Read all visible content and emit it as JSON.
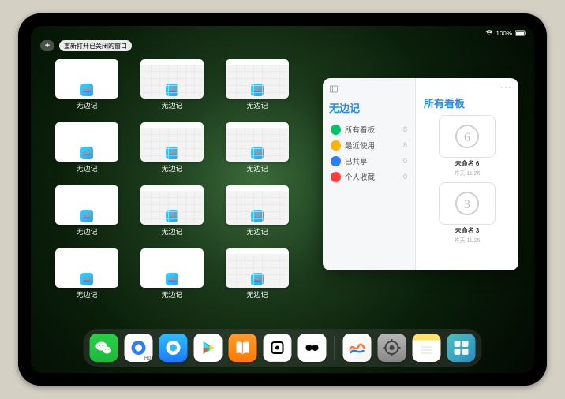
{
  "status": {
    "time": "",
    "battery": "100%"
  },
  "controls": {
    "plus_label": "+",
    "reopen_label": "重新打开已关闭的窗口"
  },
  "window_grid": {
    "app_label": "无边记",
    "items": [
      {
        "variant": "blank"
      },
      {
        "variant": "cal"
      },
      {
        "variant": "cal"
      },
      {
        "variant": "blank"
      },
      {
        "variant": "cal"
      },
      {
        "variant": "cal"
      },
      {
        "variant": "blank"
      },
      {
        "variant": "cal"
      },
      {
        "variant": "cal"
      },
      {
        "variant": "blank"
      },
      {
        "variant": "blank"
      },
      {
        "variant": "cal"
      }
    ]
  },
  "side_panel": {
    "left_title": "无边记",
    "categories": [
      {
        "label": "所有看板",
        "count": "8",
        "color": "#00c46a"
      },
      {
        "label": "最近使用",
        "count": "8",
        "color": "#ffb300"
      },
      {
        "label": "已共享",
        "count": "0",
        "color": "#2b7dff"
      },
      {
        "label": "个人收藏",
        "count": "0",
        "color": "#ff3b3b"
      }
    ],
    "right_title": "所有看板",
    "more_label": "···",
    "boards": [
      {
        "name": "未命名 6",
        "sub": "昨天 11:26",
        "digit": "6"
      },
      {
        "name": "未命名 3",
        "sub": "昨天 11:25",
        "digit": "3"
      }
    ]
  },
  "dock": {
    "icons": [
      {
        "name": "wechat-icon",
        "cls": "di-wechat"
      },
      {
        "name": "qq-hd-icon",
        "cls": "di-qqhd"
      },
      {
        "name": "qq-icon",
        "cls": "di-qq"
      },
      {
        "name": "play-store-icon",
        "cls": "di-play"
      },
      {
        "name": "books-icon",
        "cls": "di-books"
      },
      {
        "name": "ar-icon",
        "cls": "di-ar"
      },
      {
        "name": "lens-icon",
        "cls": "di-lens"
      }
    ],
    "recents": [
      {
        "name": "freeform-icon",
        "cls": "di-free"
      },
      {
        "name": "settings-icon",
        "cls": "di-set"
      },
      {
        "name": "notes-icon",
        "cls": "di-notes"
      },
      {
        "name": "app-library-icon",
        "cls": "di-lib"
      }
    ]
  }
}
